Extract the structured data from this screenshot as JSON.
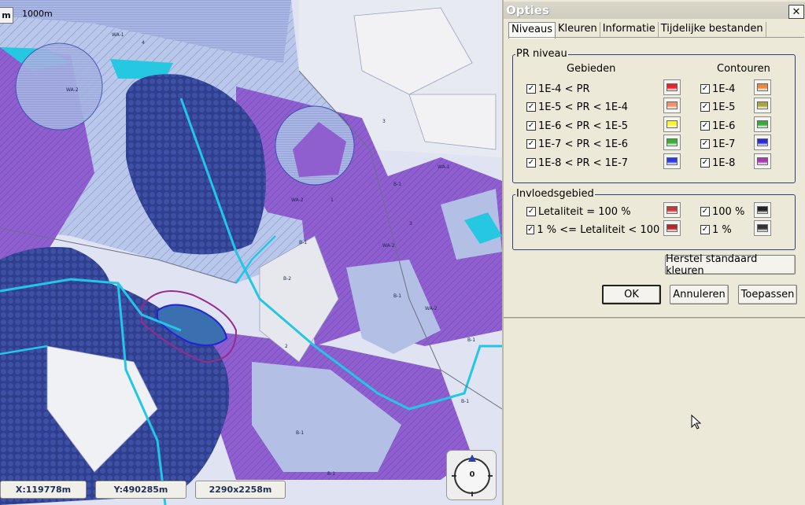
{
  "map": {
    "scale_button": "m",
    "scale_label": "1000m",
    "coords": {
      "x": "X:119778m",
      "y": "Y:490285m",
      "size": "2290x2258m"
    },
    "compass_value": "0",
    "labels": [
      "WA-1",
      "WA-2",
      "WA-2",
      "WA-2",
      "WA-1",
      "B-1",
      "B-1",
      "B-2",
      "B-1",
      "WA-2",
      "B-1",
      "B-1",
      "B-1",
      "B-1",
      "2",
      "3",
      "4",
      "3",
      "1"
    ]
  },
  "dialog": {
    "title": "Opties",
    "close": "✕",
    "tabs": [
      "Niveaus",
      "Kleuren",
      "Informatie",
      "Tijdelijke bestanden"
    ],
    "active_tab": "Niveaus",
    "pr": {
      "legend": "PR niveau",
      "gebieden_header": "Gebieden",
      "contouren_header": "Contouren",
      "rows": [
        {
          "gebied": "1E-4 < PR",
          "g_color": "#e8232b",
          "contour": "1E-4",
          "c_color": "#e98a3a"
        },
        {
          "gebied": "1E-5 < PR < 1E-4",
          "g_color": "#f2926c",
          "contour": "1E-5",
          "c_color": "#a9a43c"
        },
        {
          "gebied": "1E-6 < PR < 1E-5",
          "g_color": "#fbf330",
          "contour": "1E-6",
          "c_color": "#3aa83a"
        },
        {
          "gebied": "1E-7 < PR < 1E-6",
          "g_color": "#38b038",
          "contour": "1E-7",
          "c_color": "#2a2ad8"
        },
        {
          "gebied": "1E-8 < PR < 1E-7",
          "g_color": "#2b3be0",
          "contour": "1E-8",
          "c_color": "#a83ab0"
        }
      ]
    },
    "invloed": {
      "legend": "Invloedsgebied",
      "rows": [
        {
          "label": "Letaliteit = 100 %",
          "color": "#c43a3a",
          "contour": "100 %",
          "c_color": "#222222"
        },
        {
          "label": "1 % <= Letaliteit < 100 %",
          "color": "#b02a2a",
          "contour": "1 %",
          "c_color": "#333333"
        }
      ]
    },
    "buttons": {
      "reset": "Herstel standaard kleuren",
      "ok": "OK",
      "cancel": "Annuleren",
      "apply": "Toepassen"
    }
  }
}
